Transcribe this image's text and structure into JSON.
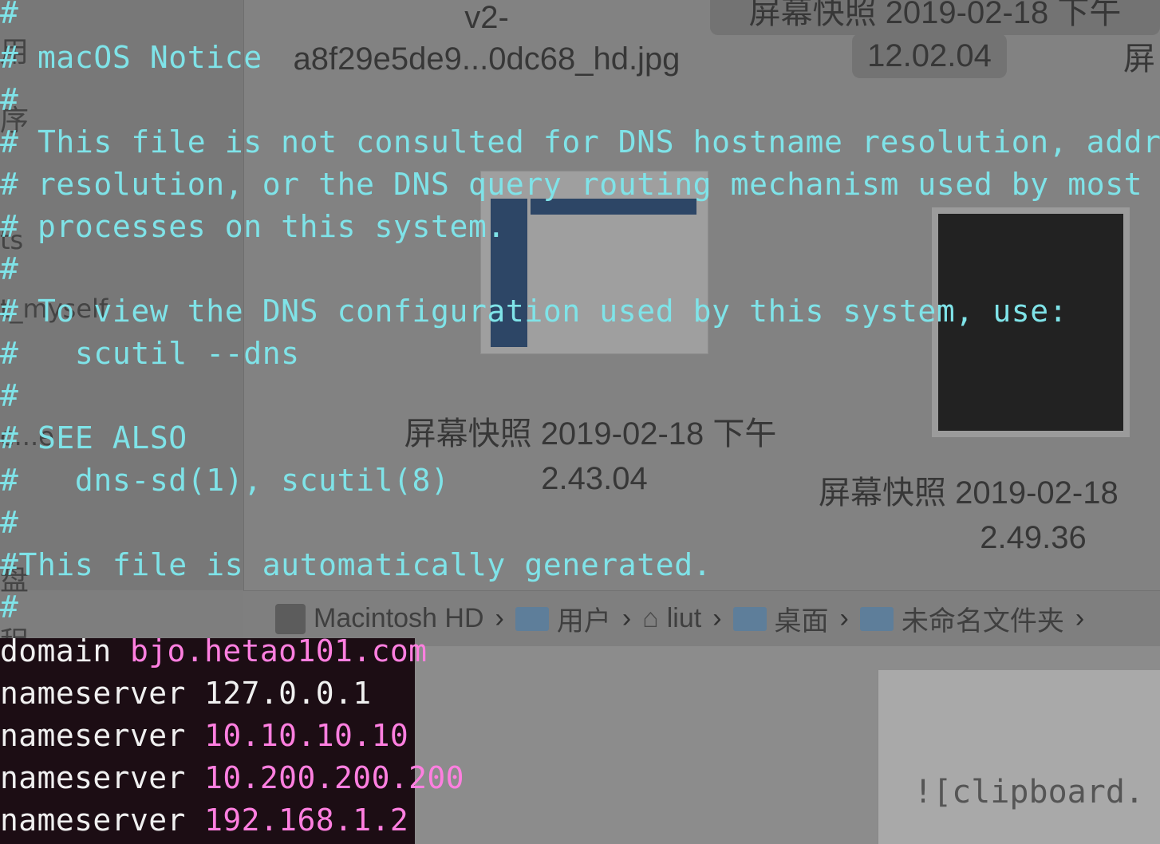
{
  "finder": {
    "sidebar_chars": [
      "用",
      "序",
      "ts",
      "t_myself",
      "c...e",
      "盘",
      "程"
    ],
    "files": [
      {
        "name_line1": "v2-",
        "name_line2": "a8f29e5de9...0dc68_hd.jpg"
      },
      {
        "name_line1": "屏幕快照 2019-02-18 下午",
        "name_line2": "12.02.04"
      },
      {
        "name_line1": "屏幕快照 2019-02-18 下午",
        "name_line2": "2.43.04"
      },
      {
        "name_line1": "屏幕快照 2019-02-18",
        "name_line2": "2.49.36"
      },
      {
        "name_line1": "屏",
        "name_line2": ""
      }
    ],
    "pathbar": {
      "disk": "Macintosh HD",
      "users": "用户",
      "home": "liut",
      "desktop": "桌面",
      "folder": "未命名文件夹"
    },
    "editor_text": "![clipboard."
  },
  "terminal": {
    "lines": [
      "#",
      "# macOS Notice",
      "#",
      "# This file is not consulted for DNS hostname resolution, address",
      "# resolution, or the DNS query routing mechanism used by most",
      "# processes on this system.",
      "#",
      "# To view the DNS configuration used by this system, use:",
      "#   scutil --dns",
      "#",
      "# SEE ALSO",
      "#   dns-sd(1), scutil(8)",
      "#",
      "#This file is automatically generated.",
      "#"
    ]
  },
  "resolv": [
    {
      "key": "domain",
      "value": "bjo.hetao101.com"
    },
    {
      "key": "nameserver",
      "value": "127.0.0.1"
    },
    {
      "key": "nameserver",
      "value": "10.10.10.10"
    },
    {
      "key": "nameserver",
      "value": "10.200.200.200"
    },
    {
      "key": "nameserver",
      "value": "192.168.1.2"
    }
  ],
  "colors": {
    "comment": "#7fe3e8",
    "value": "#ff7fe0",
    "terminal_bg": "#1c0d14"
  }
}
